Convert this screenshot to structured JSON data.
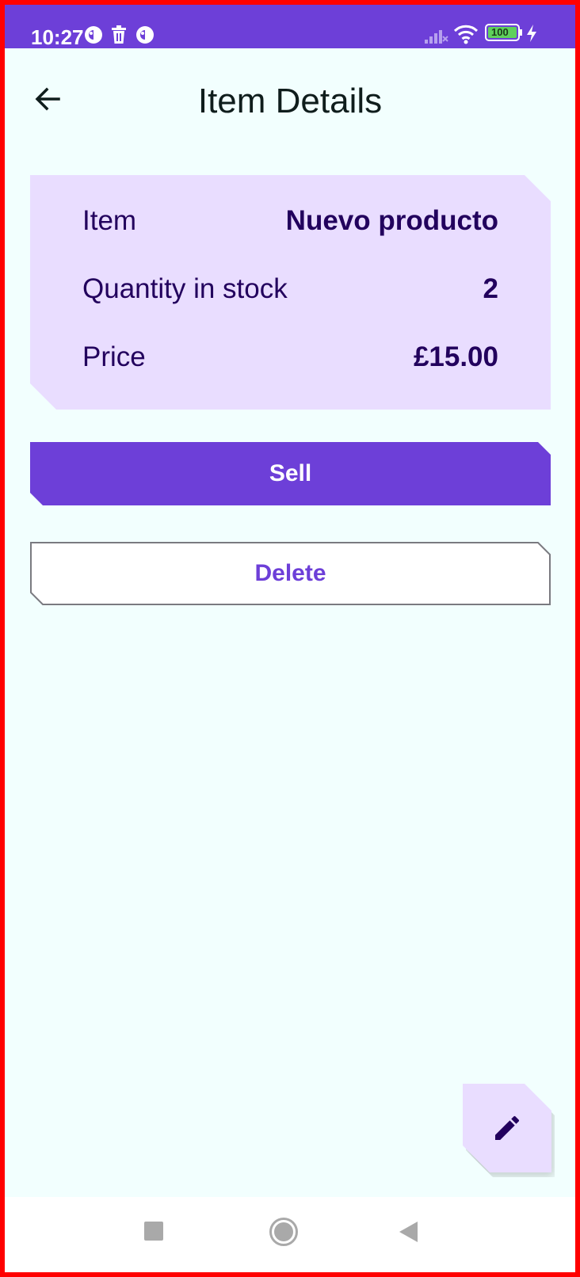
{
  "status_bar": {
    "time": "10:27",
    "battery": "100",
    "icons": [
      "app-notification-icon",
      "trash-icon",
      "app-notification-icon",
      "cell-signal-icon",
      "wifi-icon",
      "battery-icon",
      "charging-bolt-icon"
    ],
    "background_color": "#6d3fd8"
  },
  "app_bar": {
    "title": "Item Details",
    "back_icon": "arrow-left-icon"
  },
  "item_card": {
    "rows": [
      {
        "label": "Item",
        "value": "Nuevo producto"
      },
      {
        "label": "Quantity in stock",
        "value": "2"
      },
      {
        "label": "Price",
        "value": "£15.00"
      }
    ],
    "background_color": "#e9ddff",
    "text_color": "#22005d"
  },
  "actions": {
    "sell_label": "Sell",
    "delete_label": "Delete",
    "primary_color": "#6d3fd8"
  },
  "fab": {
    "icon": "pencil-edit-icon"
  },
  "nav_bar": {
    "icons": [
      "recents-square-icon",
      "home-circle-icon",
      "back-triangle-icon"
    ]
  }
}
